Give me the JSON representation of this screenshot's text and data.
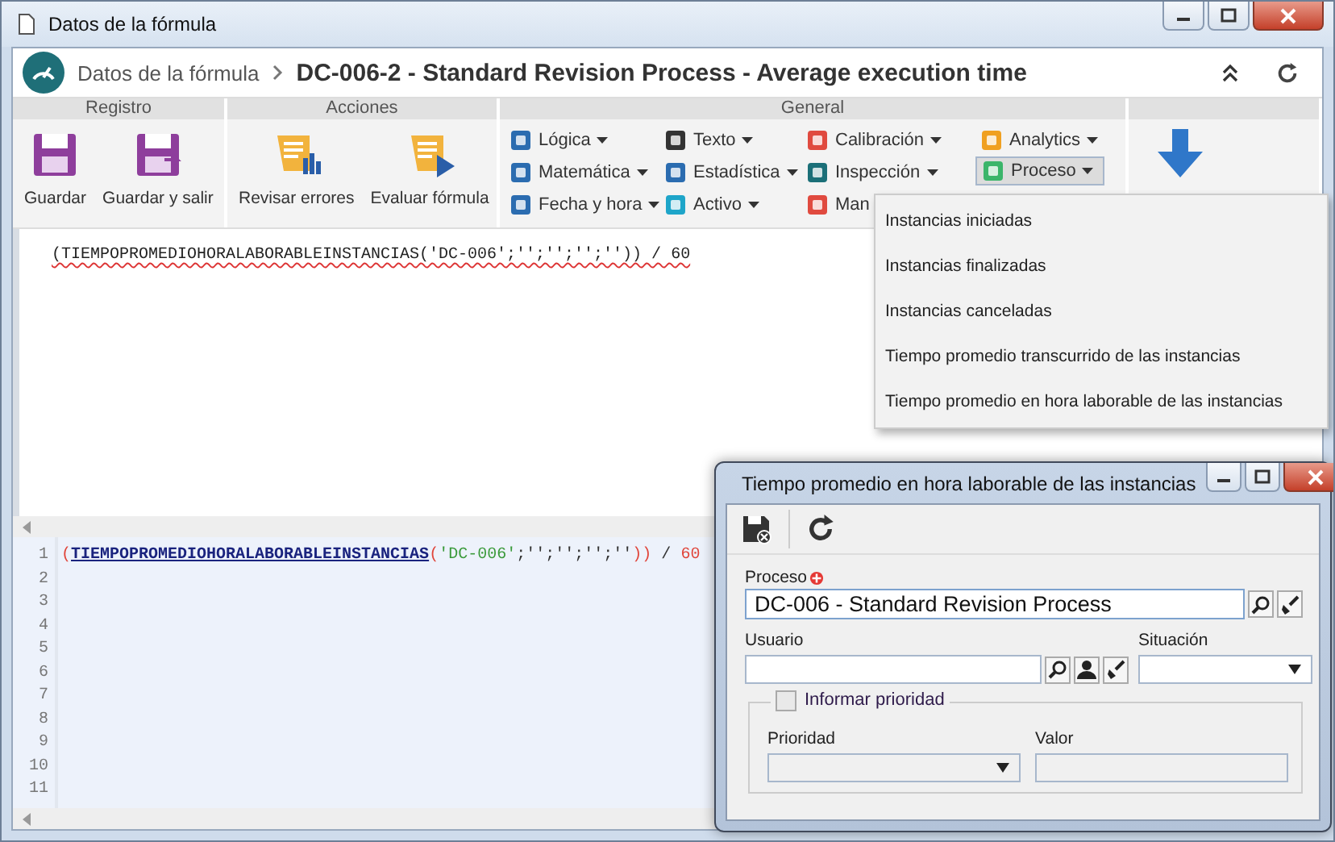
{
  "window": {
    "title": "Datos de la fórmula"
  },
  "header": {
    "breadcrumb": "Datos de la fórmula",
    "title": "DC-006-2 - Standard Revision Process - Average execution time"
  },
  "ribbon": {
    "registro": {
      "title": "Registro",
      "buttons": [
        "Guardar",
        "Guardar y salir"
      ]
    },
    "acciones": {
      "title": "Acciones",
      "buttons": [
        "Revisar errores",
        "Evaluar fórmula"
      ]
    },
    "general": {
      "title": "General",
      "columns": [
        [
          {
            "label": "Lógica",
            "selected": false,
            "has_menu": true
          },
          {
            "label": "Matemática",
            "selected": false,
            "has_menu": true
          },
          {
            "label": "Fecha y hora",
            "selected": false,
            "has_menu": true
          }
        ],
        [
          {
            "label": "Texto",
            "selected": false,
            "has_menu": true
          },
          {
            "label": "Estadística",
            "selected": false,
            "has_menu": true
          },
          {
            "label": "Activo",
            "selected": false,
            "has_menu": true
          }
        ],
        [
          {
            "label": "Calibración",
            "selected": false,
            "has_menu": true
          },
          {
            "label": "Inspección",
            "selected": false,
            "has_menu": true
          },
          {
            "label": "Man",
            "selected": false,
            "has_menu": false
          }
        ],
        [
          {
            "label": "Analytics",
            "selected": false,
            "has_menu": true
          },
          {
            "label": "Proceso",
            "selected": true,
            "has_menu": true
          }
        ]
      ]
    }
  },
  "editor": {
    "formula": "(TIEMPOPROMEDIOHORALABORABLEINSTANCIAS('DC-006';'';'';'';'')) / 60",
    "line_numbers": [
      "1",
      "2",
      "3",
      "4",
      "5",
      "6",
      "7",
      "8",
      "9",
      "10",
      "11"
    ],
    "tokens": [
      {
        "kind": "paren",
        "text": "("
      },
      {
        "kind": "function",
        "text": "TIEMPOPROMEDIOHORALABORABLEINSTANCIAS"
      },
      {
        "kind": "paren",
        "text": "("
      },
      {
        "kind": "string",
        "text": "'DC-006'"
      },
      {
        "kind": "punct",
        "text": ";''"
      },
      {
        "kind": "punct",
        "text": ";''"
      },
      {
        "kind": "punct",
        "text": ";''"
      },
      {
        "kind": "punct",
        "text": ";''"
      },
      {
        "kind": "paren",
        "text": "))"
      },
      {
        "kind": "punct",
        "text": " / "
      },
      {
        "kind": "number",
        "text": "60"
      }
    ]
  },
  "menu": {
    "items": [
      "Instancias iniciadas",
      "Instancias finalizadas",
      "Instancias canceladas",
      "Tiempo promedio transcurrido de las instancias",
      "Tiempo promedio en hora laborable de las instancias"
    ]
  },
  "dialog": {
    "title": "Tiempo promedio en hora laborable de las instancias",
    "proceso": {
      "label": "Proceso",
      "required": true,
      "value": "DC-006 - Standard Revision Process"
    },
    "usuario": {
      "label": "Usuario"
    },
    "situacion": {
      "label": "Situación"
    },
    "prioridad_group": {
      "label": "Informar prioridad",
      "checked": false
    },
    "prioridad": {
      "label": "Prioridad",
      "disabled": true
    },
    "valor": {
      "label": "Valor",
      "disabled": true
    }
  }
}
